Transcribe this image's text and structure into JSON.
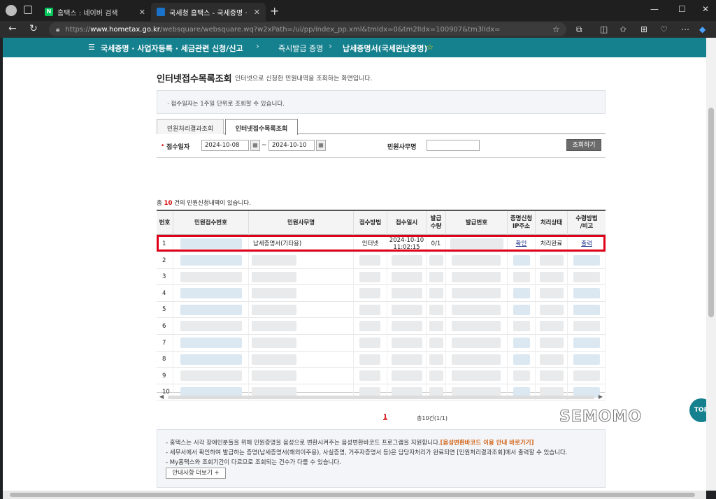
{
  "browser": {
    "tabs": [
      {
        "title": "홈택스 : 네이버 검색",
        "favicon_color": "#03c75a",
        "favicon_text": "N"
      },
      {
        "title": "국세청 홈택스 - 국세증명 · 사업자",
        "favicon_color": "#1a73c8"
      }
    ],
    "url_prefix": "https://",
    "url_host": "www.hometax.go.kr",
    "url_path": "/websquare/websquare.wq?w2xPath=/ui/pp/index_pp.xml&tmIdx=0&tm2lIdx=100907&tm3lIdx="
  },
  "gnb": {
    "menu": "국세증명 · 사업자등록 · 세금관련 신청/신고",
    "sub": "즉시발급 증명",
    "current": "납세증명서(국세완납증명)"
  },
  "page": {
    "title": "인터넷접수목록조회",
    "desc": "인터넷으로 신청한 민원내역을 조회하는 화면입니다.",
    "notice": "· 접수일자는 1주일 단위로 조회할 수 있습니다."
  },
  "tabs": [
    "민원처리결과조회",
    "인터넷접수목록조회"
  ],
  "search": {
    "date_label": "접수일자",
    "from": "2024-10-08",
    "to": "2024-10-10",
    "tilde": "~",
    "service_label": "민원사무명",
    "button": "조회하기"
  },
  "count": {
    "prefix": "총 ",
    "num": "10",
    "suffix": " 건의 민원신청내역이 있습니다."
  },
  "grid": {
    "headers": [
      "번호",
      "민원접수번호",
      "민원사무명",
      "접수방법",
      "접수일시",
      "발급\n수량",
      "발급번호",
      "증명신청\nIP주소",
      "처리상태",
      "수령방법\n/비고"
    ],
    "first_row": {
      "no": "1",
      "service": "납세증명서(기타용)",
      "method": "인터넷",
      "datetime": "2024-10-10\n11:02:15",
      "qty": "0/1",
      "ip": "확인",
      "status": "처리완료",
      "remark": "출력"
    },
    "row_numbers": [
      "2",
      "3",
      "4",
      "5",
      "6",
      "7",
      "8",
      "9",
      "10"
    ]
  },
  "paging": {
    "page": "1",
    "total": "총10건(1/1)"
  },
  "guide": {
    "line1": "- 홈택스는 시각 장애인분들을 위해 민원증명을 음성으로 변환시켜주는 음성변환바코드 프로그램을 지원합니다.",
    "line1_link": "[음성변환바코드 이용 안내 바로가기]",
    "line2": "- 세무서에서 확인하여 발급하는 증명(납세증명서(해외이주용), 사실증명, 거주자증명서 등)은 담당자처리가 완료되면 [민원처리결과조회]에서 출력할 수 있습니다.",
    "line3": "- My홈택스와 조회기간이 다르므로 조회되는 건수가 다를 수 있습니다.",
    "more_button": "안내사항 더보기 +"
  },
  "watermark": "SEMOMO",
  "top_button": "TOP",
  "colors": {
    "brand": "#15808e",
    "highlight": "#e0001a",
    "link": "#1a2f8a"
  }
}
